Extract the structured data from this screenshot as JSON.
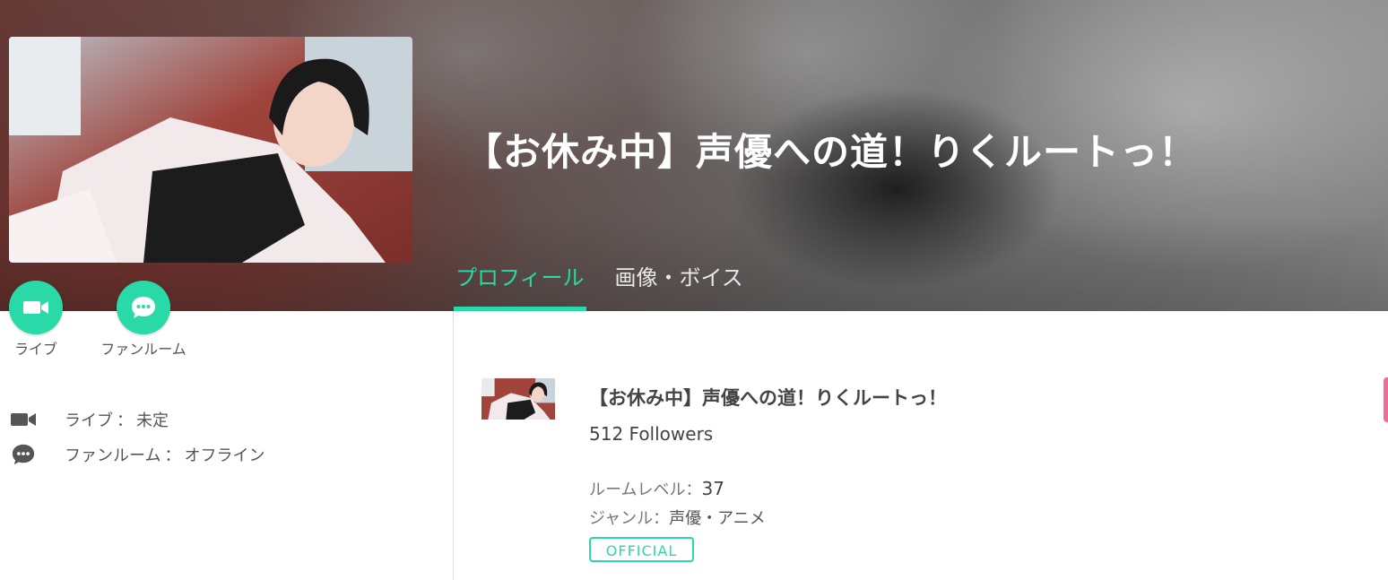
{
  "header": {
    "title": "【お休み中】声優への道！りくルートっ！",
    "tabs": [
      {
        "label": "プロフィール",
        "active": true
      },
      {
        "label": "画像・ボイス",
        "active": false
      }
    ]
  },
  "actions": {
    "live_label": "ライブ",
    "fanroom_label": "ファンルーム"
  },
  "status": {
    "live": {
      "label": "ライブ",
      "separator": "：",
      "value": "未定"
    },
    "fanroom": {
      "label": "ファンルーム",
      "separator": "：",
      "value": "オフライン"
    }
  },
  "card": {
    "title": "【お休み中】声優への道！りくルートっ！",
    "followers": "512 Followers",
    "room_level": {
      "label": "ルームレベル",
      "separator": "：",
      "value": "37"
    },
    "genre": {
      "label": "ジャンル",
      "separator": "：",
      "value": "声優・アニメ"
    },
    "badge": "OFFICIAL"
  },
  "colors": {
    "accent": "#29d9a8",
    "pink_tab": "#f06b9a"
  },
  "icons": {
    "live": "video-camera-icon",
    "fanroom": "chat-bubble-icon"
  }
}
